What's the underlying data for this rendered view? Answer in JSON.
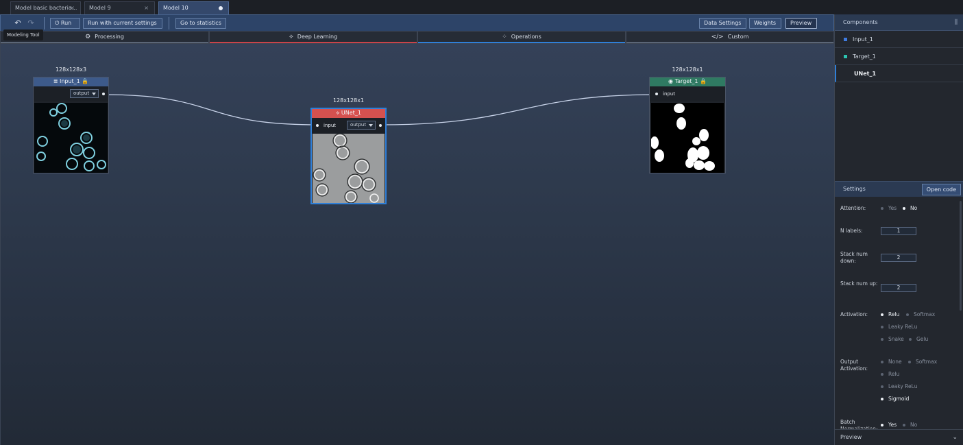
{
  "tabs": [
    {
      "label": "Model basic bacteria...",
      "closable": true
    },
    {
      "label": "Model 9",
      "closable": true
    },
    {
      "label": "Model 10",
      "active": true,
      "unsaved": true
    }
  ],
  "toolbar": {
    "undo_icon": "undo-icon",
    "redo_icon": "redo-icon",
    "run_label": "Run",
    "run_icon": "power-icon",
    "run_current_label": "Run with current settings",
    "stats_label": "Go to statistics",
    "data_settings_label": "Data Settings",
    "weights_label": "Weights",
    "preview_label": "Preview",
    "tooltip": "Modeling Tool"
  },
  "categories": [
    {
      "label": "Processing",
      "icon": "gear-icon",
      "accent": "#5b6677"
    },
    {
      "label": "Deep Learning",
      "icon": "network-icon",
      "accent": "#c9434a"
    },
    {
      "label": "Operations",
      "icon": "grid-icon",
      "accent": "#2f7fd8"
    },
    {
      "label": "Custom",
      "icon": "code-icon",
      "accent": "#5b6677"
    }
  ],
  "nodes": {
    "input": {
      "size": "128x128x3",
      "title": "Input_1",
      "output_label": "output",
      "color": "#3d5a8a"
    },
    "unet": {
      "size": "128x128x1",
      "title": "UNet_1",
      "input_label": "input",
      "output_label": "output",
      "color": "#d5514f"
    },
    "target": {
      "size": "128x128x1",
      "title": "Target_1",
      "input_label": "input",
      "color": "#2f7a62"
    }
  },
  "components": {
    "title": "Components",
    "items": [
      {
        "label": "Input_1",
        "color": "#3f7be0"
      },
      {
        "label": "Target_1",
        "color": "#2cc3b0"
      },
      {
        "label": "UNet_1",
        "selected": true
      }
    ]
  },
  "settings": {
    "title": "Settings",
    "open_code_label": "Open code",
    "attention": {
      "label": "Attention:",
      "options": [
        "Yes",
        "No"
      ],
      "selected": "No"
    },
    "n_labels": {
      "label": "N labels:",
      "value": "1"
    },
    "stack_down": {
      "label": "Stack num down:",
      "value": "2"
    },
    "stack_up": {
      "label": "Stack num up:",
      "value": "2"
    },
    "activation": {
      "label": "Activation:",
      "options": [
        "Relu",
        "Softmax",
        "Leaky ReLu",
        "Snake",
        "Gelu"
      ],
      "selected": "Relu"
    },
    "output_activation": {
      "label": "Output Activation:",
      "options": [
        "None",
        "Softmax",
        "Relu",
        "Leaky ReLu",
        "Sigmoid"
      ],
      "selected": "Sigmoid"
    },
    "batch_norm": {
      "label": "Batch Normalization:",
      "options": [
        "Yes",
        "No"
      ],
      "selected": "Yes"
    }
  },
  "preview_footer": "Preview"
}
